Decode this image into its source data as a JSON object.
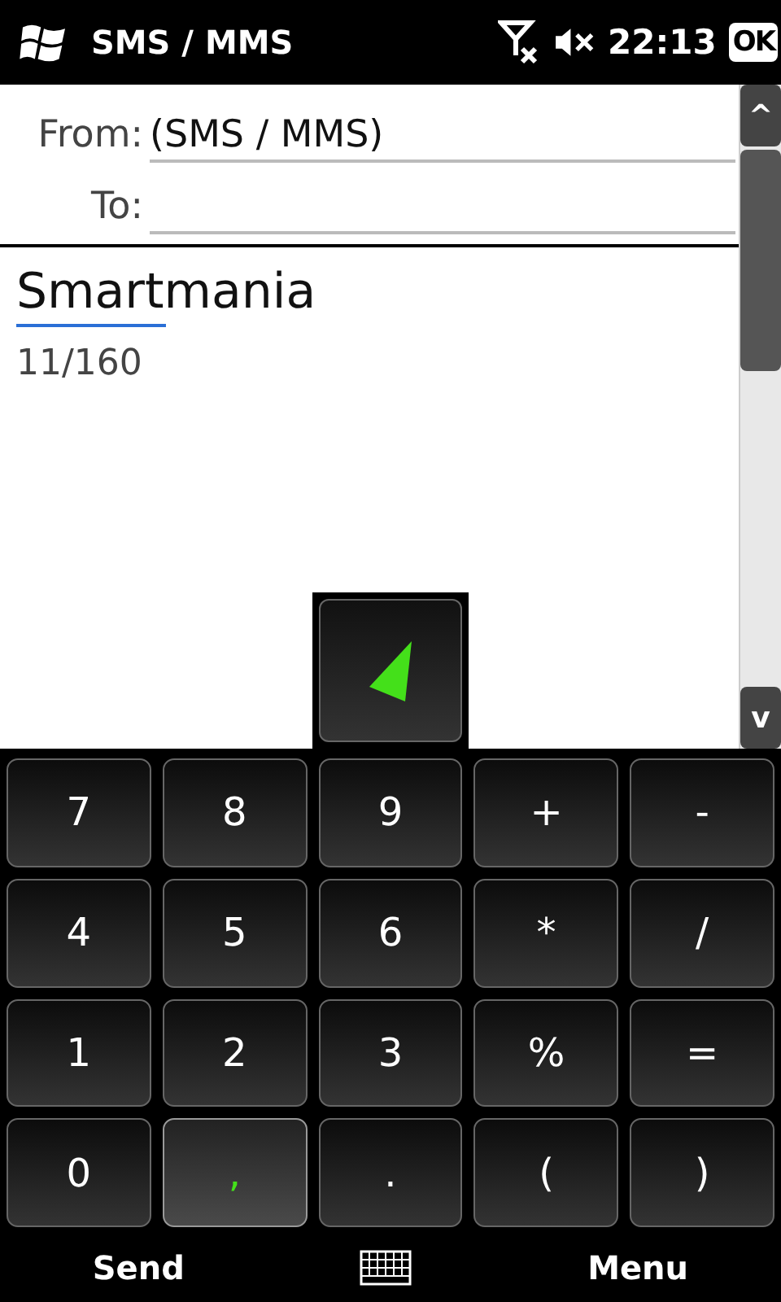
{
  "title_bar": {
    "title": "SMS / MMS",
    "time": "22:13",
    "ok": "OK"
  },
  "header": {
    "from_label": "From:",
    "from_value": "(SMS / MMS)",
    "to_label": "To:"
  },
  "body": {
    "text": "Smartmania",
    "counter": "11/160"
  },
  "scrollbar": {
    "up": "^",
    "down": "v"
  },
  "keypad": {
    "keys": [
      {
        "label": "7",
        "selected": false
      },
      {
        "label": "8",
        "selected": false
      },
      {
        "label": "9",
        "selected": false
      },
      {
        "label": "+",
        "selected": false
      },
      {
        "label": "-",
        "selected": false
      },
      {
        "label": "4",
        "selected": false
      },
      {
        "label": "5",
        "selected": false
      },
      {
        "label": "6",
        "selected": false
      },
      {
        "label": "*",
        "selected": false
      },
      {
        "label": "/",
        "selected": false
      },
      {
        "label": "1",
        "selected": false
      },
      {
        "label": "2",
        "selected": false
      },
      {
        "label": "3",
        "selected": false
      },
      {
        "label": "%",
        "selected": false
      },
      {
        "label": "=",
        "selected": false
      },
      {
        "label": "0",
        "selected": false
      },
      {
        "label": ",",
        "selected": true
      },
      {
        "label": ".",
        "selected": false
      },
      {
        "label": "(",
        "selected": false
      },
      {
        "label": ")",
        "selected": false
      }
    ]
  },
  "softkeys": {
    "left": "Send",
    "right": "Menu"
  }
}
